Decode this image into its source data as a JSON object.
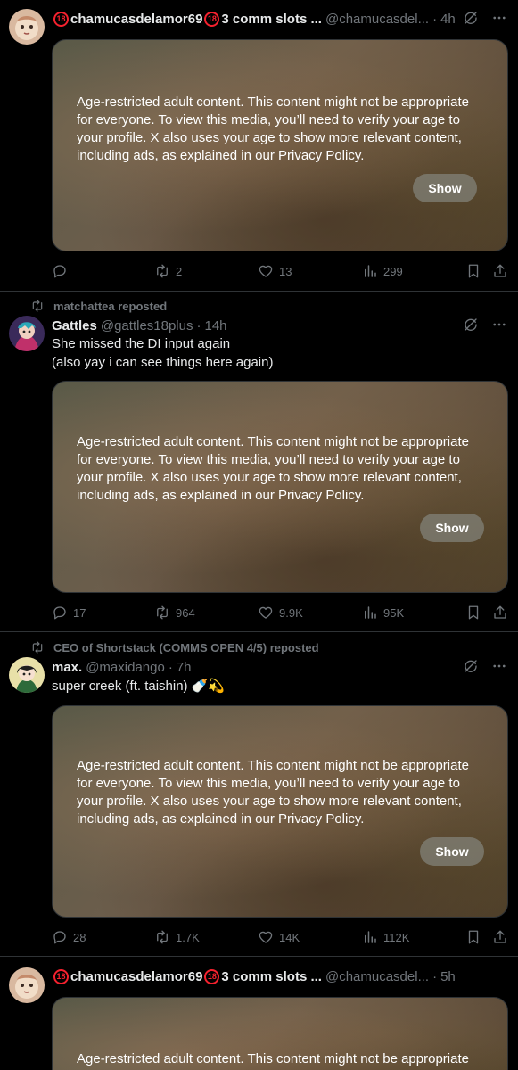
{
  "age_notice": "Age-restricted adult content. This content might not be appropriate for everyone. To view this media, you’ll need to verify your age to your profile. X also uses your age to show more relevant content, including ads, as explained in our Privacy Policy.",
  "show_label": "Show",
  "tweets": [
    {
      "name": "chamucasdelamor69",
      "badge": "18",
      "name_suffix": "3 comm slots ...",
      "handle": "@chamucasdel...",
      "dot": "·",
      "time": "4h",
      "stats": {
        "reply": "",
        "repost": "2",
        "like": "13",
        "views": "299"
      }
    },
    {
      "reposted_by": "matchattea reposted",
      "name": "Gattles",
      "handle": "@gattles18plus",
      "dot": "·",
      "time": "14h",
      "text_lines": [
        "She missed the DI input again",
        "(also yay i can see things here again)"
      ],
      "stats": {
        "reply": "17",
        "repost": "964",
        "like": "9.9K",
        "views": "95K"
      }
    },
    {
      "reposted_by": "CEO of Shortstack (COMMS OPEN 4/5) reposted",
      "name": "max.",
      "handle": "@maxidango",
      "dot": "·",
      "time": "7h",
      "text_lines": [
        "super creek (ft. taishin) 🍼💫"
      ],
      "stats": {
        "reply": "28",
        "repost": "1.7K",
        "like": "14K",
        "views": "112K"
      }
    },
    {
      "name": "chamucasdelamor69",
      "badge": "18",
      "name_suffix": "3 comm slots ...",
      "handle": "@chamucasdel...",
      "dot": "·",
      "time": "5h"
    }
  ],
  "icons": {
    "reply": "reply-icon",
    "repost": "repost-icon",
    "like": "heart-icon",
    "views": "views-icon",
    "bookmark": "bookmark-icon",
    "share": "share-icon",
    "grok": "grok-icon",
    "more": "more-icon"
  },
  "colors": {
    "background": "#000000",
    "text": "#e7e9ea",
    "muted": "#71767b",
    "divider": "#2f3336",
    "badge": "#f4212e"
  }
}
